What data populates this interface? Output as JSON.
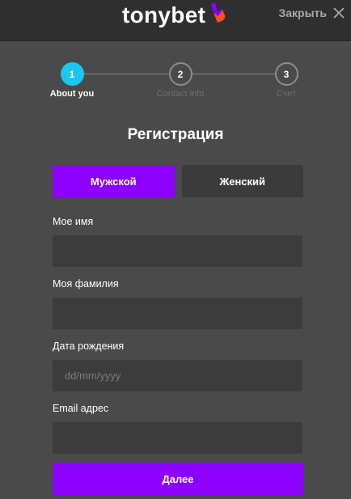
{
  "header": {
    "logo_text": "tonybet",
    "close_label": "Закрыть",
    "brand_colors": {
      "mark_purple": "#8b00ff",
      "mark_orange": "#ff4d1f"
    }
  },
  "steps": [
    {
      "number": "1",
      "label": "About you",
      "active": true
    },
    {
      "number": "2",
      "label": "Contact info",
      "active": false
    },
    {
      "number": "3",
      "label": "Счет",
      "active": false
    }
  ],
  "form": {
    "title": "Регистрация",
    "gender": {
      "male_label": "Мужской",
      "female_label": "Женский",
      "selected": "male"
    },
    "first_name": {
      "label": "Мое имя",
      "value": ""
    },
    "last_name": {
      "label": "Моя фамилия",
      "value": ""
    },
    "birth_date": {
      "label": "Дата рождения",
      "placeholder": "dd/mm/yyyy",
      "value": ""
    },
    "email": {
      "label": "Email адрес",
      "value": ""
    },
    "next_label": "Далее"
  },
  "colors": {
    "background": "#4a4a4a",
    "header": "#2f2f2f",
    "accent": "#8b00ff",
    "step_active": "#19c8f0",
    "input_bg": "#3c3c3c"
  }
}
